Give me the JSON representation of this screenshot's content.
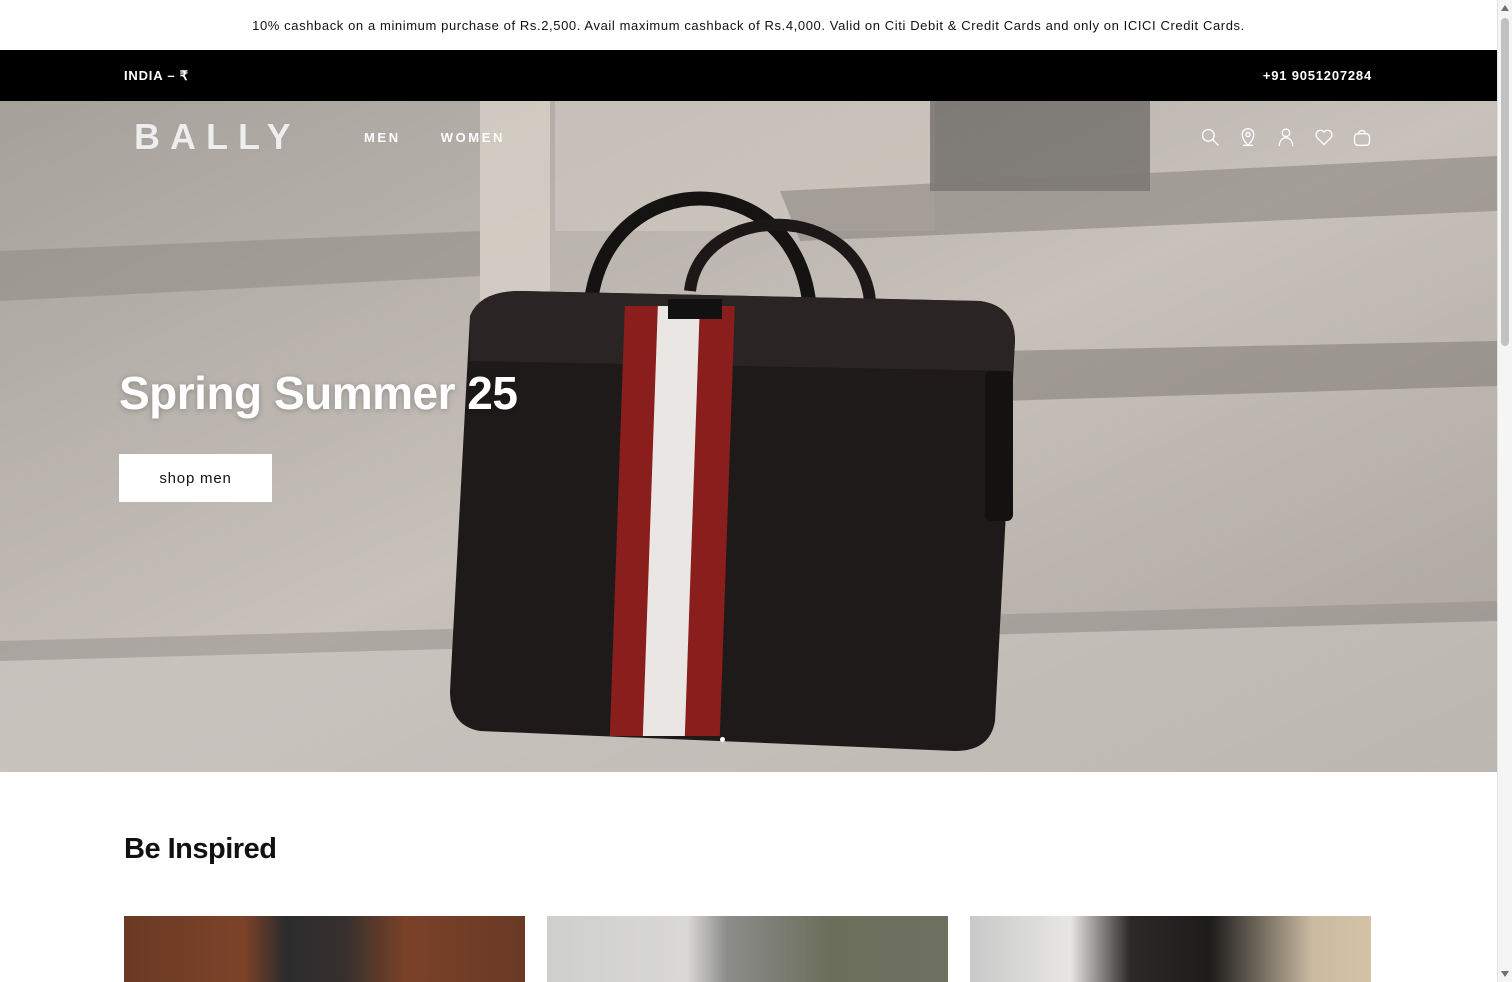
{
  "promo": {
    "text": "10% cashback on a minimum purchase of Rs.2,500. Avail maximum cashback of Rs.4,000. Valid on Citi Debit & Credit Cards and only on ICICI Credit Cards."
  },
  "utility": {
    "region": "INDIA – ₹",
    "phone": "+91 9051207284"
  },
  "nav": {
    "logo": "BALLY",
    "links": [
      "MEN",
      "WOMEN"
    ],
    "icons": [
      "search-icon",
      "store-locator-icon",
      "account-icon",
      "wishlist-icon",
      "bag-icon"
    ]
  },
  "hero": {
    "title": "Spring Summer 25",
    "cta": "shop men",
    "carousel_active_index": 1
  },
  "section": {
    "title": "Be Inspired"
  },
  "colors": {
    "promo_bg": "#ffffff",
    "utility_bg": "#000000",
    "bag_stripe_red": "#8a1e1c",
    "bag_leather": "#1f1a1a"
  }
}
